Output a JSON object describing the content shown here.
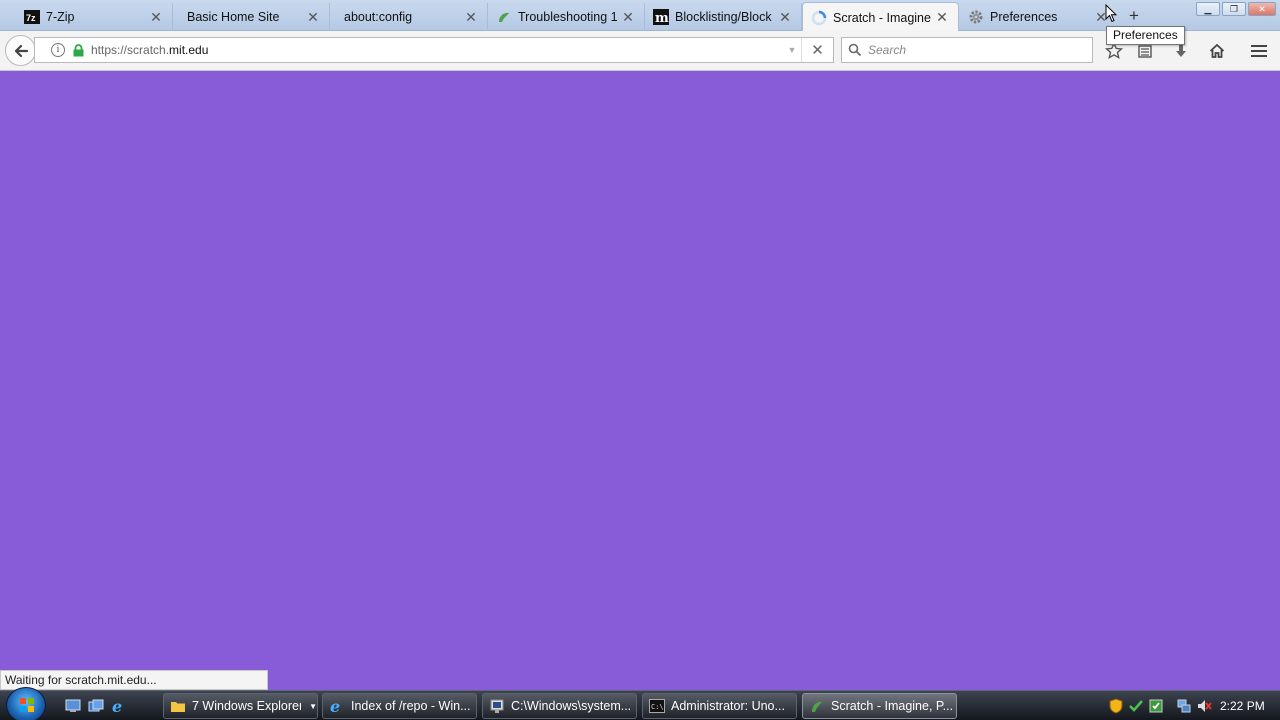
{
  "tabs": [
    {
      "label": "7-Zip",
      "icon": "7zip-icon"
    },
    {
      "label": "Basic Home Site",
      "icon": "none"
    },
    {
      "label": "about:config",
      "icon": "none"
    },
    {
      "label": "Troubleshooting 1",
      "icon": "scratch-cat-icon"
    },
    {
      "label": "Blocklisting/Block",
      "icon": "m-logo-icon"
    },
    {
      "label": "Scratch - Imagine,",
      "icon": "loading-spinner-icon",
      "active": true
    },
    {
      "label": "Preferences",
      "icon": "gear-icon"
    }
  ],
  "tab_close_glyph": "✕",
  "new_tab_glyph": "+",
  "window_buttons": {
    "minimize": "▁",
    "restore": "❐",
    "close": "✕"
  },
  "tooltip": "Preferences",
  "navbar": {
    "url_prefix": "https://scratch.",
    "url_domain": "mit.edu",
    "search_placeholder": "Search",
    "stop_glyph": "✕"
  },
  "status_text": "Waiting for scratch.mit.edu...",
  "content_color": "#885cd9",
  "taskbar": {
    "items": [
      {
        "label": "7 Windows Explorer",
        "icon": "folder-icon"
      },
      {
        "label": "Index of /repo - Win...",
        "icon": "ie-icon"
      },
      {
        "label": "C:\\Windows\\system...",
        "icon": "console-icon"
      },
      {
        "label": "Administrator:  Uno...",
        "icon": "cmd-icon"
      },
      {
        "label": "Scratch - Imagine, P...",
        "icon": "scratch-icon",
        "active": true
      }
    ],
    "clock": "2:22 PM"
  }
}
